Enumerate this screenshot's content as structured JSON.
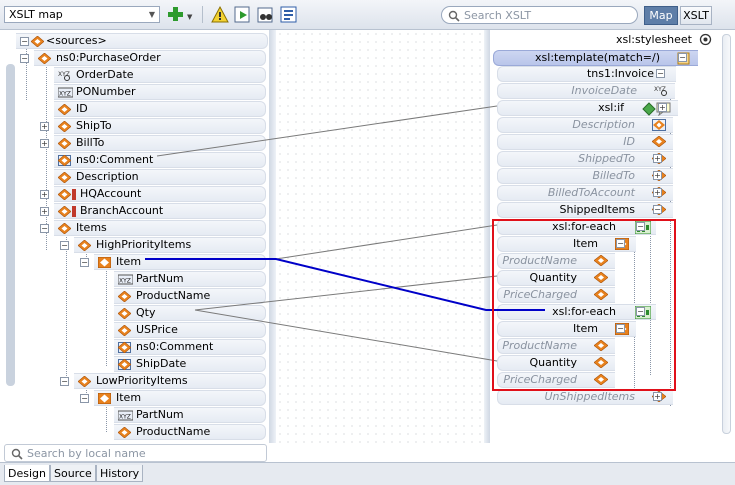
{
  "toolbar": {
    "view_selector": "XSLT map",
    "search_placeholder": "Search XSLT",
    "map_tab": "Map",
    "xslt_tab": "XSLT"
  },
  "source_tree": {
    "root": "<sources>",
    "items": [
      {
        "label": "ns0:PurchaseOrder",
        "type": "element"
      },
      {
        "label": "OrderDate",
        "type": "attribute"
      },
      {
        "label": "PONumber",
        "type": "text"
      },
      {
        "label": "ID",
        "type": "element"
      },
      {
        "label": "ShipTo",
        "type": "element"
      },
      {
        "label": "BillTo",
        "type": "element"
      },
      {
        "label": "ns0:Comment",
        "type": "element-ref"
      },
      {
        "label": "Description",
        "type": "element"
      },
      {
        "label": "HQAccount",
        "type": "element"
      },
      {
        "label": "BranchAccount",
        "type": "element"
      },
      {
        "label": "Items",
        "type": "element"
      },
      {
        "label": "HighPriorityItems",
        "type": "element"
      },
      {
        "label": "Item",
        "type": "repeating-element"
      },
      {
        "label": "PartNum",
        "type": "text"
      },
      {
        "label": "ProductName",
        "type": "element"
      },
      {
        "label": "Qty",
        "type": "element"
      },
      {
        "label": "USPrice",
        "type": "element"
      },
      {
        "label": "ns0:Comment",
        "type": "element-ref"
      },
      {
        "label": "ShipDate",
        "type": "element-ref"
      },
      {
        "label": "LowPriorityItems",
        "type": "element"
      },
      {
        "label": "Item",
        "type": "repeating-element"
      },
      {
        "label": "PartNum",
        "type": "text"
      },
      {
        "label": "ProductName",
        "type": "element"
      }
    ],
    "search_placeholder": "Search by local name"
  },
  "target_tree": {
    "root": "xsl:stylesheet",
    "items": [
      {
        "label": "xsl:template(match=/)"
      },
      {
        "label": "tns1:Invoice"
      },
      {
        "label": "InvoiceDate"
      },
      {
        "label": "xsl:if"
      },
      {
        "label": "Description"
      },
      {
        "label": "ID"
      },
      {
        "label": "ShippedTo"
      },
      {
        "label": "BilledTo"
      },
      {
        "label": "BilledToAccount"
      },
      {
        "label": "ShippedItems"
      },
      {
        "label": "xsl:for-each"
      },
      {
        "label": "Item"
      },
      {
        "label": "ProductName"
      },
      {
        "label": "Quantity"
      },
      {
        "label": "PriceCharged"
      },
      {
        "label": "xsl:for-each"
      },
      {
        "label": "Item"
      },
      {
        "label": "ProductName"
      },
      {
        "label": "Quantity"
      },
      {
        "label": "PriceCharged"
      },
      {
        "label": "UnShippedItems"
      }
    ]
  },
  "bottom_tabs": [
    "Design",
    "Source",
    "History"
  ],
  "colors": {
    "accent": "#5e7ea8",
    "highlight_box": "#e0101a",
    "mapping_active": "#0000c8",
    "mapping_normal": "#7a7a7a"
  }
}
